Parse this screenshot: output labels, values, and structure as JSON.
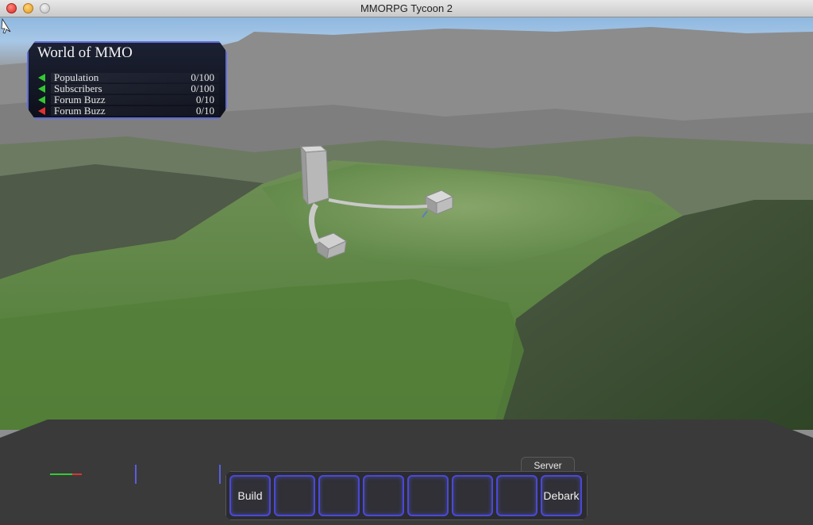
{
  "window": {
    "title": "MMORPG Tycoon 2"
  },
  "stats_panel": {
    "title": "World of MMO",
    "rows": [
      {
        "label": "Population",
        "value": "0/100",
        "trend": "up",
        "trend_color": "#33c833"
      },
      {
        "label": "Subscribers",
        "value": "0/100",
        "trend": "up",
        "trend_color": "#33c833"
      },
      {
        "label": "Forum Buzz",
        "value": "0/10",
        "trend": "up",
        "trend_color": "#33c833"
      },
      {
        "label": "Forum Buzz",
        "value": "0/10",
        "trend": "down",
        "trend_color": "#e03030"
      }
    ]
  },
  "toolbar": {
    "tab_label": "Server",
    "build_label": "Build",
    "debark_label": "Debark",
    "empty_slots": 6
  },
  "colors": {
    "accent": "#5f6cd8",
    "slot_border": "#4a49d6"
  }
}
